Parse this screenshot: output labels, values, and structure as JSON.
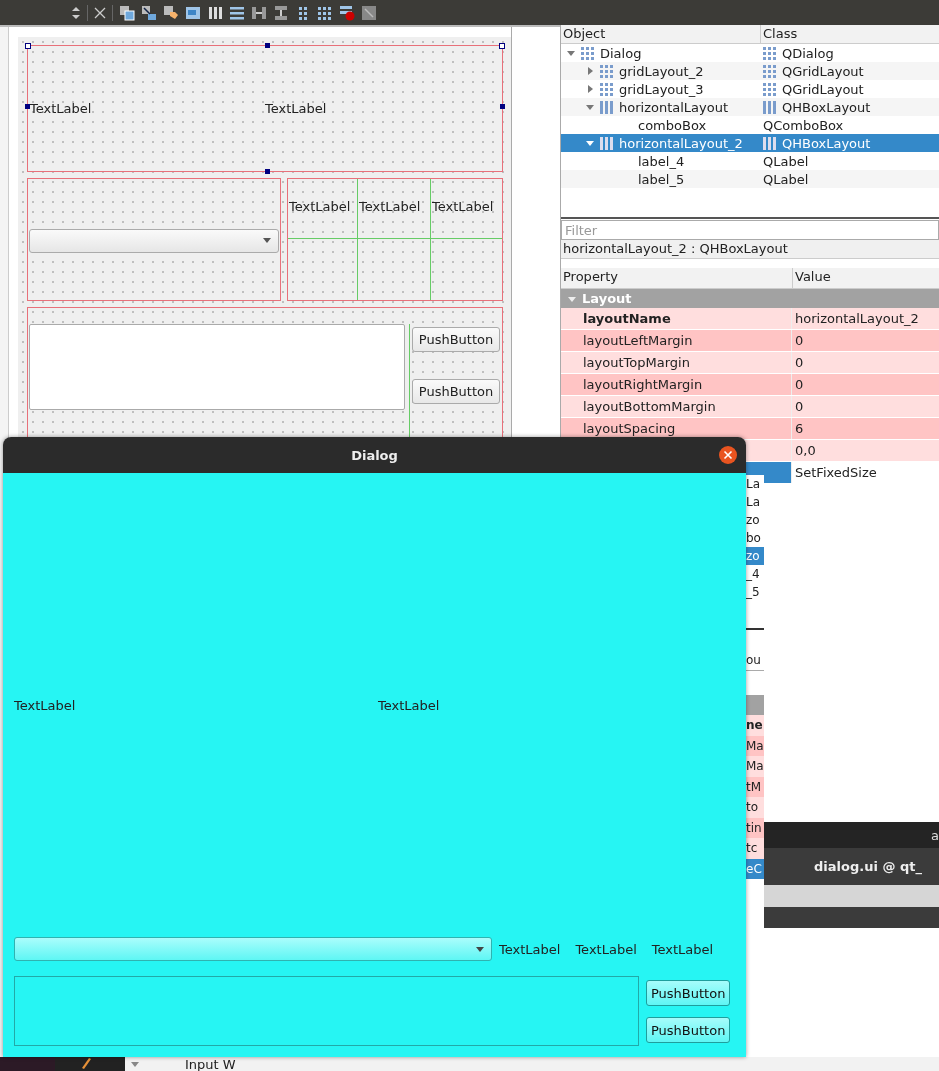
{
  "designer": {
    "form": {
      "top_labels": [
        "TextLabel",
        "TextLabel"
      ],
      "grid_labels": [
        "TextLabel",
        "TextLabel",
        "TextLabel"
      ],
      "buttons": [
        "PushButton",
        "PushButton"
      ]
    },
    "object_inspector": {
      "columns": [
        "Object",
        "Class"
      ],
      "items": [
        {
          "name": "Dialog",
          "class": "QDialog",
          "kind": "grid",
          "expanded": true,
          "selected": false,
          "children": [
            {
              "name": "gridLayout_2",
              "class": "QGridLayout",
              "kind": "grid",
              "expanded": false,
              "selected": false
            },
            {
              "name": "gridLayout_3",
              "class": "QGridLayout",
              "kind": "grid",
              "expanded": false,
              "selected": false
            },
            {
              "name": "horizontalLayout",
              "class": "QHBoxLayout",
              "kind": "hbox",
              "expanded": true,
              "selected": false,
              "children": [
                {
                  "name": "comboBox",
                  "class": "QComboBox",
                  "selected": false
                }
              ]
            },
            {
              "name": "horizontalLayout_2",
              "class": "QHBoxLayout",
              "kind": "hbox",
              "expanded": true,
              "selected": true,
              "children": [
                {
                  "name": "label_4",
                  "class": "QLabel",
                  "selected": false
                },
                {
                  "name": "label_5",
                  "class": "QLabel",
                  "selected": false
                }
              ]
            }
          ]
        }
      ]
    },
    "property_editor": {
      "filter_placeholder": "Filter",
      "caption": "horizontalLayout_2 : QHBoxLayout",
      "columns": [
        "Property",
        "Value"
      ],
      "group": {
        "label": "Layout",
        "expanded": true
      },
      "rows": [
        {
          "name": "layoutName",
          "value": "horizontalLayout_2",
          "bold": true,
          "selected": false
        },
        {
          "name": "layoutLeftMargin",
          "value": "0",
          "bold": false,
          "selected": false
        },
        {
          "name": "layoutTopMargin",
          "value": "0",
          "bold": false,
          "selected": false
        },
        {
          "name": "layoutRightMargin",
          "value": "0",
          "bold": false,
          "selected": false
        },
        {
          "name": "layoutBottomMargin",
          "value": "0",
          "bold": false,
          "selected": false
        },
        {
          "name": "layoutSpacing",
          "value": "6",
          "bold": false,
          "selected": false
        },
        {
          "value": "0,0",
          "selected": false
        },
        {
          "value": "SetFixedSize",
          "selected": true
        }
      ]
    }
  },
  "dialog": {
    "title": "Dialog",
    "top_labels": [
      "TextLabel",
      "TextLabel"
    ],
    "row_labels": [
      "TextLabel",
      "TextLabel",
      "TextLabel"
    ],
    "buttons": [
      "PushButton",
      "PushButton"
    ]
  },
  "back_window": {
    "fragments": [
      {
        "text": "La",
        "selected": false
      },
      {
        "text": "La",
        "selected": false
      },
      {
        "text": "zo",
        "selected": false
      },
      {
        "text": "bo",
        "selected": false
      },
      {
        "text": "zo",
        "selected": true
      },
      {
        "text": "_4",
        "selected": false
      },
      {
        "text": "_5",
        "selected": false
      }
    ],
    "lower_fragments": [
      {
        "text": "ou",
        "selected": false
      }
    ],
    "property_fragments": [
      {
        "text": "ne",
        "selected": false
      },
      {
        "text": "Ma",
        "selected": false
      },
      {
        "text": "Ma",
        "selected": false
      },
      {
        "text": "tM",
        "selected": false
      },
      {
        "text": "to",
        "selected": false
      },
      {
        "text": "tin",
        "selected": false
      },
      {
        "text": "tc",
        "selected": false
      },
      {
        "text": "eC",
        "selected": true
      }
    ],
    "top_bar_text": "a",
    "title": "dialog.ui @ qt_"
  },
  "taskbar": {
    "text": "Input W"
  }
}
